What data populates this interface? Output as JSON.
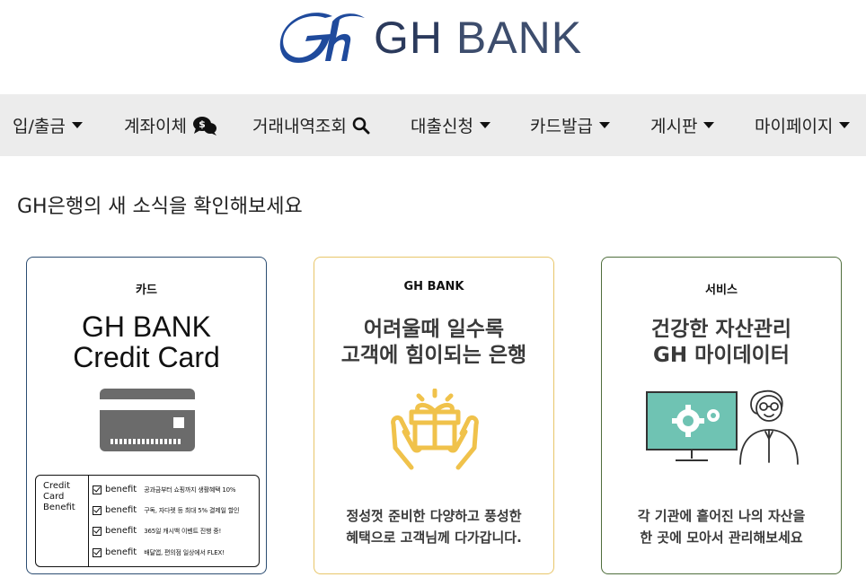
{
  "header": {
    "logo_gh": "GH",
    "logo_bank": "BANK"
  },
  "nav": {
    "items": [
      {
        "label": "입/출금",
        "icon": "caret-down-icon"
      },
      {
        "label": "계좌이체",
        "icon": "money-chat-icon"
      },
      {
        "label": "거래내역조회",
        "icon": "search-icon"
      },
      {
        "label": "대출신청",
        "icon": "caret-down-icon"
      },
      {
        "label": "카드발급",
        "icon": "caret-down-icon"
      },
      {
        "label": "게시판",
        "icon": "caret-down-icon"
      },
      {
        "label": "마이페이지",
        "icon": "caret-down-icon"
      }
    ]
  },
  "main": {
    "headline": "GH은행의 새 소식을 확인해보세요",
    "cards": [
      {
        "tag": "카드",
        "title_line1": "GH BANK",
        "title_line2": "Credit Card",
        "benefit_label": [
          "Credit",
          "Card",
          "Benefit"
        ],
        "benefits": [
          {
            "key": "benefit",
            "text": "공과금부터 쇼핑까지 생활혜택 10%"
          },
          {
            "key": "benefit",
            "text": "구독, 자다렛 등 최대 5% 결제일 할인"
          },
          {
            "key": "benefit",
            "text": "365일 캐시백 이벤트 진행 중!"
          },
          {
            "key": "benefit",
            "text": "배달앱, 편의점 일상에서 FLEX!"
          }
        ]
      },
      {
        "tag": "GH BANK",
        "title_line1": "어려울때 일수록",
        "title_line2": "고객에 힘이되는 은행",
        "desc_line1": "정성껏 준비한 다양하고 풍성한",
        "desc_line2": "혜택으로 고객님께 다가갑니다."
      },
      {
        "tag": "서비스",
        "title_line1": "건강한 자산관리",
        "title_line2": "GH 마이데이터",
        "desc_line1": "각 기관에 흩어진 나의 자산을",
        "desc_line2": "한 곳에 모아서 관리해보세요"
      }
    ]
  },
  "colors": {
    "logo_blue": "#1f4a9c",
    "nav_bg": "#ececec",
    "card1_border": "#2c4d72",
    "card2_border": "#e8c66a",
    "card3_border": "#4f6e3c",
    "gift_yellow": "#f0c24b",
    "monitor_teal": "#6fc3b3"
  }
}
